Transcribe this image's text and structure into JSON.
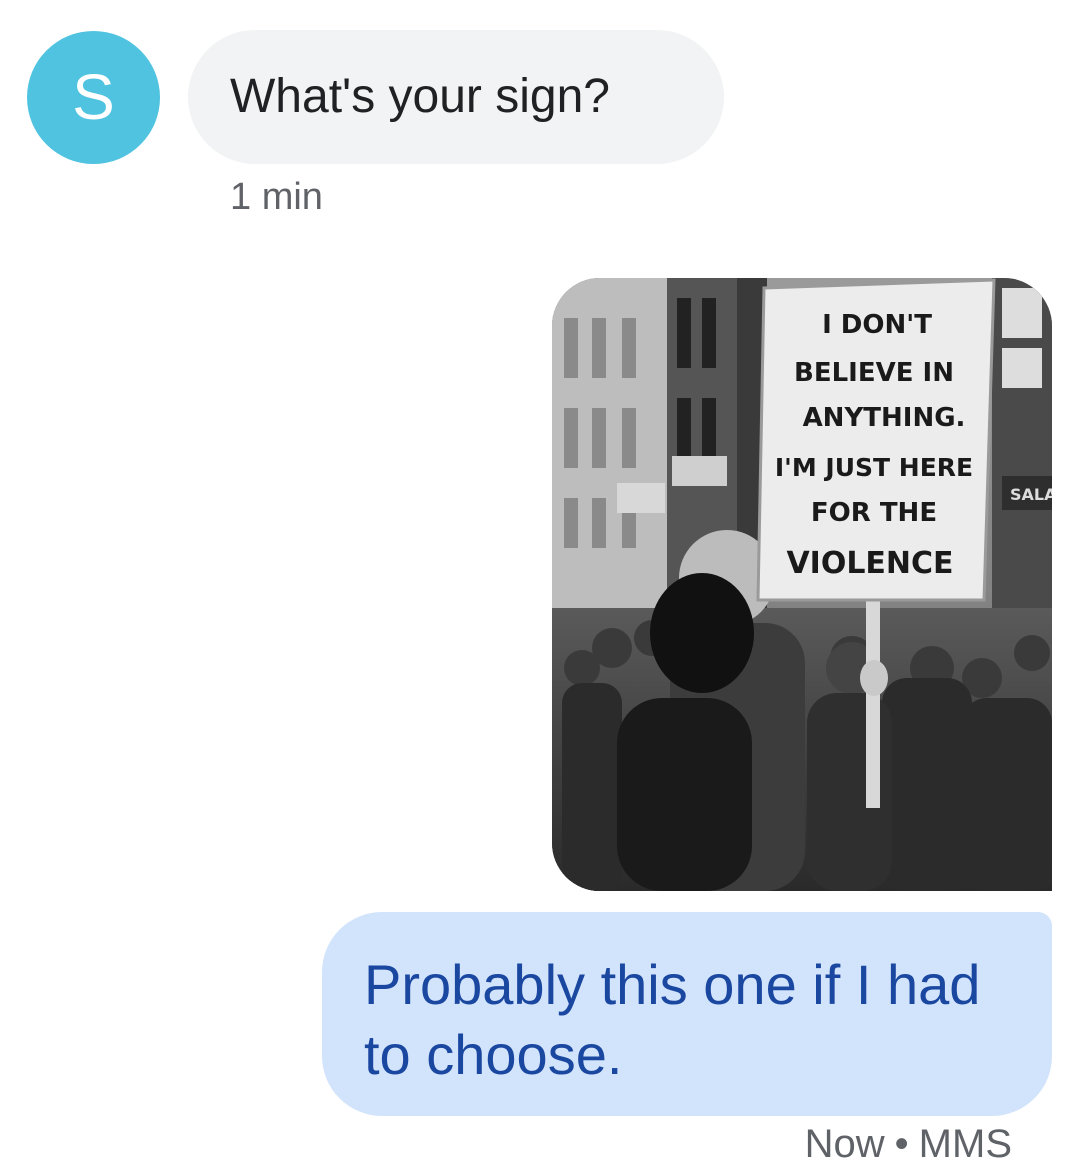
{
  "contact": {
    "avatar_initial": "S",
    "avatar_color": "#4fc3e0"
  },
  "incoming": {
    "text": "What's your sign?",
    "timestamp": "1 min"
  },
  "outgoing": {
    "text": "Probably this one if I had to choose.",
    "timestamp": "Now",
    "separator": "•",
    "type": "MMS"
  },
  "photo": {
    "sign_lines": [
      "I DON'T",
      "BELIEVE IN",
      "ANYTHING.",
      "I'M JUST HERE",
      "FOR THE",
      "VIOLENCE"
    ],
    "shop_sign": "SALA"
  },
  "colors": {
    "incoming_bubble": "#f1f3f4",
    "outgoing_bubble": "#d2e3fc",
    "outgoing_text": "#1a47a0",
    "meta_text": "#5f6368"
  }
}
